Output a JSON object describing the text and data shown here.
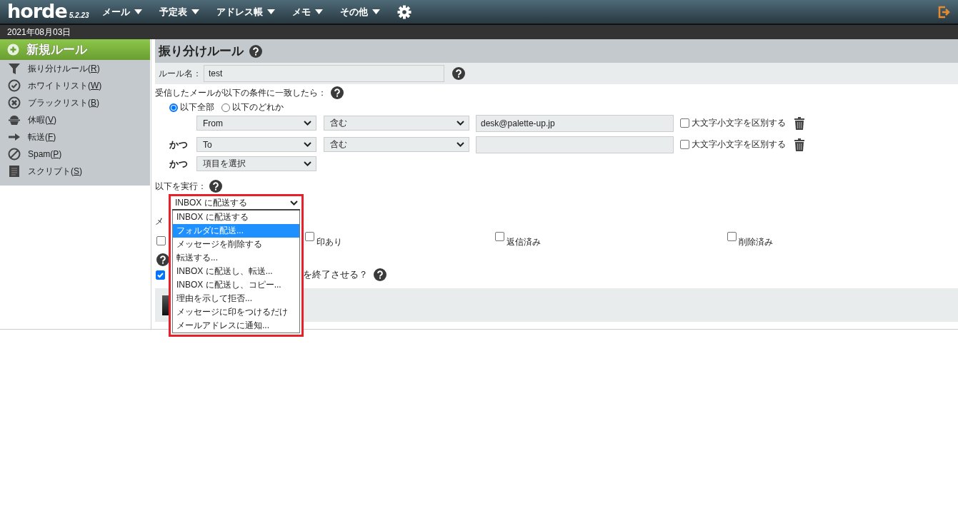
{
  "app": {
    "logo": "horde",
    "version": "5.2.23"
  },
  "menu": [
    {
      "label": "メール"
    },
    {
      "label": "予定表"
    },
    {
      "label": "アドレス帳"
    },
    {
      "label": "メモ"
    },
    {
      "label": "その他"
    }
  ],
  "date": "2021年08月03日",
  "sidebar": {
    "new_rule": "新規ルール",
    "items": [
      {
        "kind": "filter",
        "label": "振り分けルール(",
        "access_key": "R",
        "label_end": ")"
      },
      {
        "kind": "check",
        "label": "ホワイトリスト(",
        "access_key": "W",
        "label_end": ")"
      },
      {
        "kind": "cross",
        "label": "ブラックリスト(",
        "access_key": "B",
        "label_end": ")"
      },
      {
        "kind": "vacation",
        "label": "休暇(",
        "access_key": "V",
        "label_end": ")"
      },
      {
        "kind": "arrow",
        "label": "転送(",
        "access_key": "F",
        "label_end": ")"
      },
      {
        "kind": "ban",
        "label": "Spam(",
        "access_key": "P",
        "label_end": ")"
      },
      {
        "kind": "script",
        "label": "スクリプト(",
        "access_key": "S",
        "label_end": ")"
      }
    ]
  },
  "form": {
    "title": "振り分けルール",
    "rule_name_label": "ルール名：",
    "rule_name": "test",
    "conditions_heading": "受信したメールが以下の条件に一致したら：",
    "match": [
      {
        "label": "以下全部",
        "selected": true
      },
      {
        "label": "以下のどれか",
        "selected": false
      }
    ],
    "conditions": [
      {
        "kind": "full",
        "field": "From",
        "operator": "含む",
        "value": "desk@palette-up.jp",
        "case_label": "大文字小文字を区別する",
        "case_checked": false
      },
      {
        "kind": "full",
        "conjunction": "かつ",
        "field": "To",
        "operator": "含む",
        "case_label": "大文字小文字を区別する",
        "case_checked": false
      },
      {
        "kind": "field_only",
        "conjunction": "かつ",
        "field": "項目を選択"
      }
    ],
    "action_label": "以下を実行：",
    "flags_label": "メ",
    "flags": [
      {
        "checked": false
      },
      {
        "label": "印あり",
        "checked": false
      },
      {
        "label": "返信済み",
        "checked": false
      },
      {
        "label": "削除済み",
        "checked": false
      }
    ],
    "stop": {
      "checked": true,
      "label": "を終了させる？"
    }
  },
  "action_dropdown": {
    "value": "INBOX に配送する",
    "options": [
      {
        "label": "INBOX に配送する",
        "highlighted": false
      },
      {
        "label": "フォルダに配送...",
        "highlighted": true
      },
      {
        "label": "メッセージを削除する",
        "highlighted": false
      },
      {
        "label": "転送する...",
        "highlighted": false
      },
      {
        "label": "INBOX に配送し、転送...",
        "highlighted": false
      },
      {
        "label": "INBOX に配送し、コピー...",
        "highlighted": false
      },
      {
        "label": "理由を示して拒否...",
        "highlighted": false
      },
      {
        "label": "メッセージに印をつけるだけ",
        "highlighted": false
      },
      {
        "label": "メールアドレスに通知...",
        "highlighted": false
      }
    ]
  }
}
